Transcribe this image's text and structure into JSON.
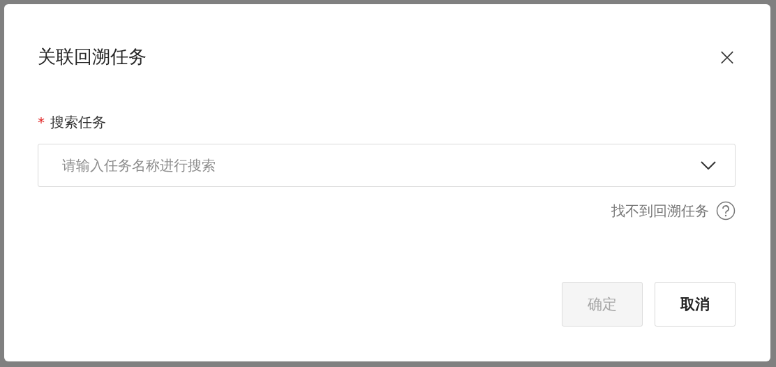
{
  "dialog": {
    "title": "关联回溯任务",
    "close_icon": "×"
  },
  "field": {
    "required_mark": "*",
    "label": "搜索任务",
    "placeholder": "请输入任务名称进行搜索"
  },
  "help_link": {
    "label": "找不到回溯任务"
  },
  "buttons": [
    {
      "label": "确定",
      "kind": "primary",
      "disabled": true
    },
    {
      "label": "取消",
      "kind": "default",
      "disabled": false
    }
  ]
}
